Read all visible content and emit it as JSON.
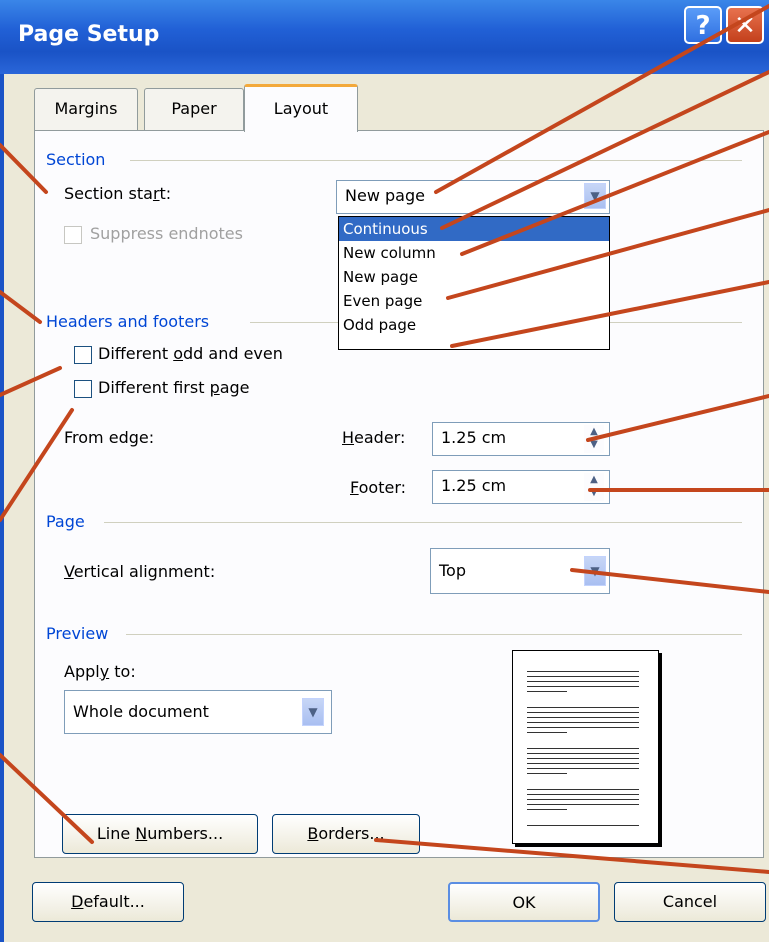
{
  "window": {
    "title": "Page Setup",
    "help_glyph": "?",
    "close_glyph": "✕"
  },
  "tabs": [
    {
      "label": "Margins"
    },
    {
      "label": "Paper"
    },
    {
      "label": "Layout"
    }
  ],
  "section": {
    "group_label": "Section",
    "start_label_pre": "Section sta",
    "start_label_key": "r",
    "start_label_post": "t:",
    "start_value": "New page",
    "suppress_endnotes_label": "Suppress endnotes",
    "options": [
      "Continuous",
      "New column",
      "New page",
      "Even page",
      "Odd page"
    ],
    "selected_option": "Continuous"
  },
  "headers_footers": {
    "group_label": "Headers and footers",
    "odd_even_pre": "Different ",
    "odd_even_key": "o",
    "odd_even_post": "dd and even",
    "first_page_pre": "Different first ",
    "first_page_key": "p",
    "first_page_post": "age",
    "from_edge_label": "From edge:",
    "header_key": "H",
    "header_rest": "eader:",
    "header_value": "1.25 cm",
    "footer_key": "F",
    "footer_rest": "ooter:",
    "footer_value": "1.25 cm"
  },
  "page": {
    "group_label": "Page",
    "valign_key": "V",
    "valign_rest": "ertical alignment:",
    "valign_value": "Top"
  },
  "preview": {
    "group_label": "Preview",
    "apply_pre": "Appl",
    "apply_key": "y",
    "apply_post": " to:",
    "apply_value": "Whole document",
    "line_numbers_pre": "Line ",
    "line_numbers_key": "N",
    "line_numbers_post": "umbers...",
    "borders_key": "B",
    "borders_rest": "orders..."
  },
  "footer_buttons": {
    "default_key": "D",
    "default_rest": "efault...",
    "ok": "OK",
    "cancel": "Cancel"
  },
  "colors": {
    "annotation_line": "#c4461d",
    "selection": "#316ac5",
    "group_header": "#0046d5"
  },
  "icons": [
    "help-icon",
    "close-icon",
    "chevron-down-icon",
    "spin-up-down-icon",
    "checkbox-icon"
  ]
}
